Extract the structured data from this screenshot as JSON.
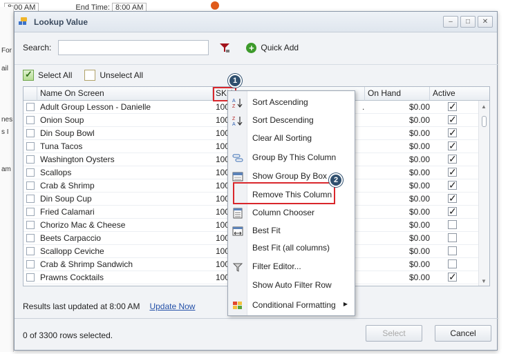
{
  "background": {
    "start_time_fragment": "8:00 AM",
    "end_time_label": "End Time:",
    "end_time_value": "8:00 AM",
    "left_fragments": [
      "For",
      "ail",
      "nes",
      "s I",
      "am"
    ]
  },
  "dialog": {
    "title": "Lookup Value",
    "window_buttons": [
      "–",
      "□",
      "✕"
    ],
    "search": {
      "label": "Search:",
      "value": "",
      "placeholder": ""
    },
    "quick_add_label": "Quick Add",
    "select_all_label": "Select All",
    "unselect_all_label": "Unselect All",
    "columns": {
      "name": "Name On Screen",
      "sku": "SKU",
      "on_hand": "On Hand",
      "active": "Active"
    },
    "rows": [
      {
        "name": "Adult Group Lesson - Danielle",
        "sku": "1000",
        "extra": ".",
        "on_hand": "$0.00",
        "active": true
      },
      {
        "name": "Onion Soup",
        "sku": "1000",
        "extra": "",
        "on_hand": "$0.00",
        "active": true
      },
      {
        "name": "Din Soup Bowl",
        "sku": "1000",
        "extra": "",
        "on_hand": "$0.00",
        "active": true
      },
      {
        "name": "Tuna Tacos",
        "sku": "1000",
        "extra": "",
        "on_hand": "$0.00",
        "active": true
      },
      {
        "name": "Washington  Oysters",
        "sku": "1000",
        "extra": "",
        "on_hand": "$0.00",
        "active": true
      },
      {
        "name": "Scallops",
        "sku": "1000",
        "extra": "",
        "on_hand": "$0.00",
        "active": true
      },
      {
        "name": "Crab & Shrimp",
        "sku": "1000",
        "extra": "",
        "on_hand": "$0.00",
        "active": true
      },
      {
        "name": "Din Soup Cup",
        "sku": "1000",
        "extra": "",
        "on_hand": "$0.00",
        "active": true
      },
      {
        "name": "Fried Calamari",
        "sku": "1000",
        "extra": "",
        "on_hand": "$0.00",
        "active": true
      },
      {
        "name": "Chorizo Mac & Cheese",
        "sku": "1000",
        "extra": "",
        "on_hand": "$0.00",
        "active": false
      },
      {
        "name": "Beets Carpaccio",
        "sku": "1000",
        "extra": "",
        "on_hand": "$0.00",
        "active": false
      },
      {
        "name": "Scallopp Ceviche",
        "sku": "1000",
        "extra": "",
        "on_hand": "$0.00",
        "active": false
      },
      {
        "name": "Crab  &  Shrimp  Sandwich",
        "sku": "1000",
        "extra": "",
        "on_hand": "$0.00",
        "active": false
      },
      {
        "name": "Prawns Cocktails",
        "sku": "1000",
        "extra": "",
        "on_hand": "$0.00",
        "active": true
      }
    ],
    "status_text": "Results last updated at 8:00 AM",
    "update_now_label": "Update Now",
    "rows_selected_text": "0 of 3300 rows selected.",
    "select_button": "Select",
    "cancel_button": "Cancel"
  },
  "context_menu": {
    "items": [
      {
        "label": "Sort Ascending",
        "icon": "sort-ascending-icon"
      },
      {
        "label": "Sort Descending",
        "icon": "sort-descending-icon"
      },
      {
        "label": "Clear All Sorting",
        "icon": ""
      },
      {
        "label": "Group By This Column",
        "icon": "group-by-icon"
      },
      {
        "label": "Show Group By Box",
        "icon": "group-box-icon"
      },
      {
        "label": "Remove This Column",
        "icon": ""
      },
      {
        "label": "Column Chooser",
        "icon": "column-chooser-icon"
      },
      {
        "label": "Best Fit",
        "icon": "best-fit-icon"
      },
      {
        "label": "Best Fit (all columns)",
        "icon": ""
      },
      {
        "label": "Filter Editor...",
        "icon": "filter-icon"
      },
      {
        "label": "Show Auto Filter Row",
        "icon": ""
      },
      {
        "label": "Conditional Formatting",
        "icon": "conditional-formatting-icon"
      }
    ]
  },
  "badges": [
    "1",
    "2"
  ],
  "colors": {
    "highlight": "#d9262b",
    "badge": "#2f4f6e",
    "link": "#2450a8"
  }
}
